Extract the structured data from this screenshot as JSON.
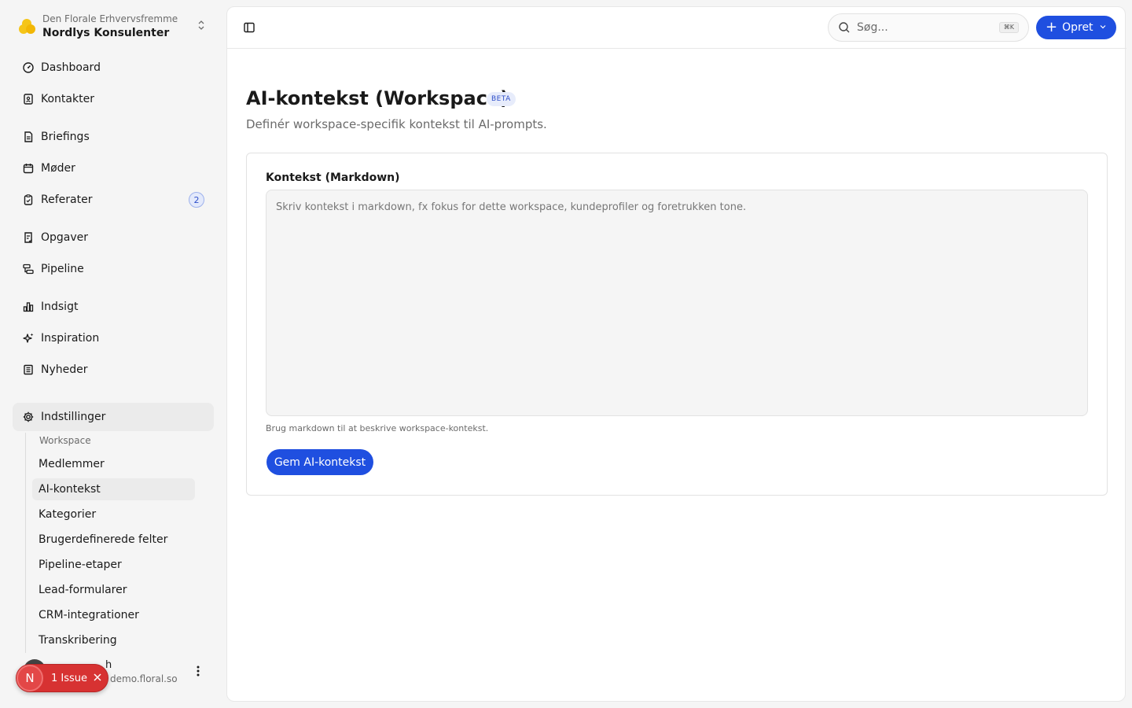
{
  "workspace": {
    "org": "Den Florale Erhvervsfremme",
    "name": "Nordlys Konsulenter"
  },
  "nav": [
    {
      "label": "Dashboard",
      "icon": "gauge-icon"
    },
    {
      "label": "Kontakter",
      "icon": "contacts-icon"
    },
    {
      "label": "Briefings",
      "icon": "document-icon"
    },
    {
      "label": "Møder",
      "icon": "calendar-icon"
    },
    {
      "label": "Referater",
      "icon": "clipboard-icon",
      "badge": "2"
    },
    {
      "label": "Opgaver",
      "icon": "tasks-icon"
    },
    {
      "label": "Pipeline",
      "icon": "pipeline-icon"
    },
    {
      "label": "Indsigt",
      "icon": "bar-chart-icon"
    },
    {
      "label": "Inspiration",
      "icon": "sparkles-icon"
    },
    {
      "label": "Nyheder",
      "icon": "newspaper-icon"
    },
    {
      "label": "Indstillinger",
      "icon": "gear-icon"
    }
  ],
  "settings": {
    "section_label": "Workspace",
    "items": [
      "Medlemmer",
      "AI-kontekst",
      "Kategorier",
      "Brugerdefinerede felter",
      "Pipeline-etaper",
      "Lead-formularer",
      "CRM-integrationer",
      "Transkribering"
    ],
    "active_item": "AI-kontekst"
  },
  "user": {
    "name": "h",
    "email": "demo.floral.so"
  },
  "issue_pill": {
    "initial": "N",
    "label": "1 Issue"
  },
  "topbar": {
    "search_placeholder": "Søg...",
    "search_shortcut": "⌘K",
    "create_label": "Opret"
  },
  "page": {
    "title": "AI-kontekst (Workspace)",
    "beta": "BETA",
    "subtitle": "Definér workspace-specifik kontekst til AI-prompts.",
    "field_label": "Kontekst (Markdown)",
    "field_value": "",
    "field_placeholder": "Skriv kontekst i markdown, fx fokus for dette workspace, kundeprofiler og foretrukken tone.",
    "help_text": "Brug markdown til at beskrive workspace-kontekst.",
    "save_label": "Gem AI-kontekst"
  },
  "colors": {
    "primary": "#1f4fe0",
    "issue": "#d73232",
    "badge_bg": "#e3e9fb"
  }
}
